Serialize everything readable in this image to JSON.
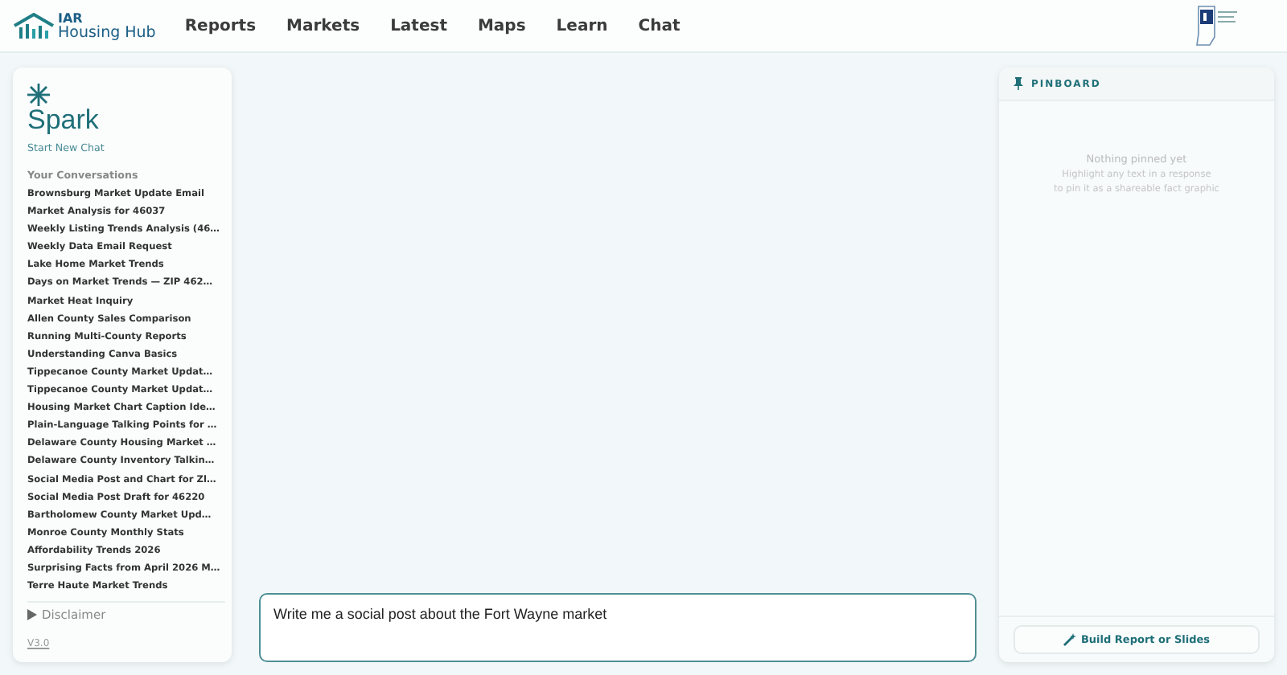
{
  "header": {
    "logo_line1": "IAR",
    "logo_line2": "Housing Hub",
    "nav": [
      {
        "label": "Reports",
        "selected": false
      },
      {
        "label": "Markets",
        "selected": false
      },
      {
        "label": "Latest",
        "selected": false
      },
      {
        "label": "Maps",
        "selected": false
      },
      {
        "label": "Learn",
        "selected": false
      },
      {
        "label": "Chat",
        "selected": false
      }
    ]
  },
  "sidebar": {
    "title": "Spark",
    "new_chat": "Start New Chat",
    "section": "Your Conversations",
    "conversations": [
      "Brownsburg Market Update Email",
      "Market Analysis for 46037",
      "Weekly Listing Trends Analysis (46…",
      "Weekly Data Email Request",
      "Lake Home Market Trends",
      "Days on Market Trends — ZIP 462…",
      "Market Heat Inquiry",
      "Allen County Sales Comparison",
      "Running Multi-County Reports",
      "Understanding Canva Basics",
      "Tippecanoe County Market Updat…",
      "Tippecanoe County Market Updat…",
      "Housing Market Chart Caption Ide…",
      "Plain-Language Talking Points for …",
      "Delaware County Housing Market …",
      "Delaware County Inventory Talkin…",
      "Social Media Post and Chart for Zl…",
      "Social Media Post Draft for 46220",
      "Bartholomew County Market Upd…",
      "Monroe County Monthly Stats",
      "Affordability Trends 2026",
      "Surprising Facts from April 2026 M…",
      "Terre Haute Market Trends"
    ],
    "disclaimer": "Disclaimer",
    "version": "V3.0"
  },
  "composer": {
    "value": "Write me a social post about the Fort Wayne market"
  },
  "pinboard": {
    "title": "PINBOARD",
    "empty_title": "Nothing pinned yet",
    "empty_line1": "Highlight any text in a response",
    "empty_line2": "to pin it as a shareable fact graphic",
    "button": "Build Report or Slides"
  }
}
